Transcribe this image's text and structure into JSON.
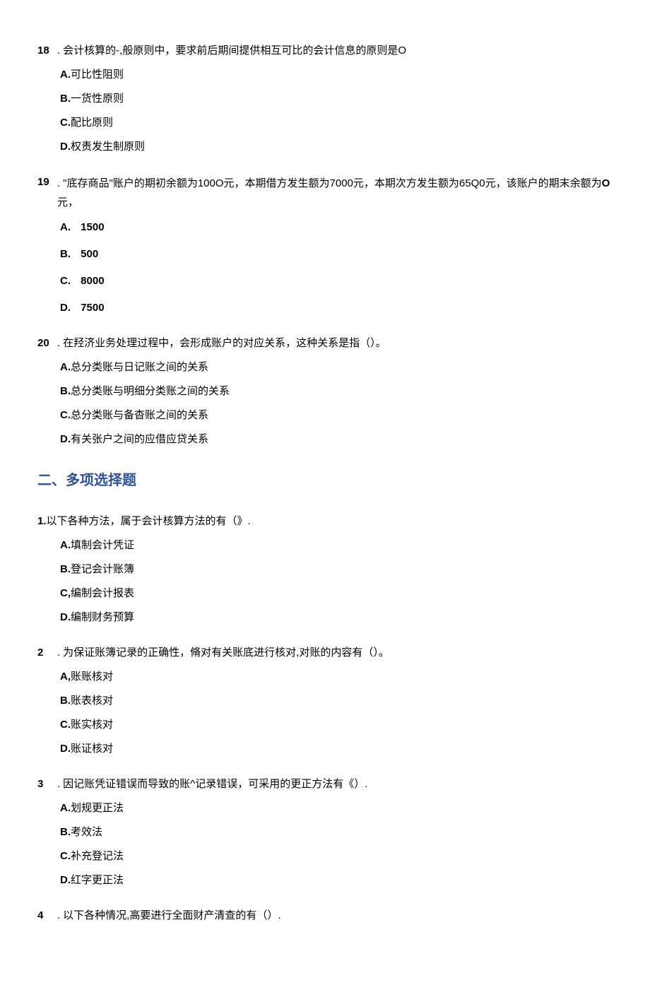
{
  "questions_s1": [
    {
      "number": "18",
      "stem": "会计核算的-,般原则中，要求前后期间提供相互可比的会计信息的原则是O",
      "options": [
        {
          "label": "A.",
          "text": "可比性阻则"
        },
        {
          "label": "B.",
          "text": "一货性原则"
        },
        {
          "label": "C.",
          "text": "配比原则"
        },
        {
          "label": "D.",
          "text": "权责发生制原则"
        }
      ]
    },
    {
      "number": "19",
      "stem": "\"底存商品\"账户的期初余额为100O元，本期借方发生额为7000元，本期次方发生额为65Q0元，该账户的期末余额为O元，",
      "options": [
        {
          "label": "A.",
          "text": "1500"
        },
        {
          "label": "B.",
          "text": "500"
        },
        {
          "label": "C.",
          "text": "8000"
        },
        {
          "label": "D.",
          "text": "7500"
        }
      ],
      "spaced": true
    },
    {
      "number": "20",
      "stem": "在羟济业务处理过程中，会形成账户的对应关系，这种关系是指（）。",
      "options": [
        {
          "label": "A.",
          "text": "总分类账与日记账之间的关系"
        },
        {
          "label": "B.",
          "text": "总分类账与明细分类账之间的关系"
        },
        {
          "label": "C.",
          "text": "总分类账与备杳账之间的关系"
        },
        {
          "label": "D.",
          "text": "有关张户之间的应借应贷关系"
        }
      ]
    }
  ],
  "section2": {
    "title": "二、多项选择题",
    "q1": {
      "number": "1.",
      "stem": "以下各种方法，属于会计核算方法的有（》.",
      "options": [
        {
          "label": "A.",
          "text": "填制会计凭证"
        },
        {
          "label": "B.",
          "text": "登记会计账簿"
        },
        {
          "label": "C,",
          "text": "编制会计报表"
        },
        {
          "label": "D.",
          "text": "编制财务预算"
        }
      ]
    },
    "questions": [
      {
        "number": "2",
        "stem": "为保证账簿记录的正确性，脩对有关账底进行核对,对账的内容有（）。",
        "options": [
          {
            "label": "A,",
            "text": "账账核对"
          },
          {
            "label": "B.",
            "text": "账表核对"
          },
          {
            "label": "C.",
            "text": "账实核对"
          },
          {
            "label": "D.",
            "text": "账证核对"
          }
        ]
      },
      {
        "number": "3",
        "stem": "因记账凭证错误而导致的账^记录错误，可采用的更正方法有《）.",
        "options": [
          {
            "label": "A.",
            "text": "划规更正法"
          },
          {
            "label": "B.",
            "text": "考效法"
          },
          {
            "label": "C.",
            "text": "补充登记法"
          },
          {
            "label": "D.",
            "text": "红字更正法"
          }
        ]
      },
      {
        "number": "4",
        "stem": "以下各种情况,高要进行全面财产清查的有（）.",
        "options": []
      }
    ]
  }
}
